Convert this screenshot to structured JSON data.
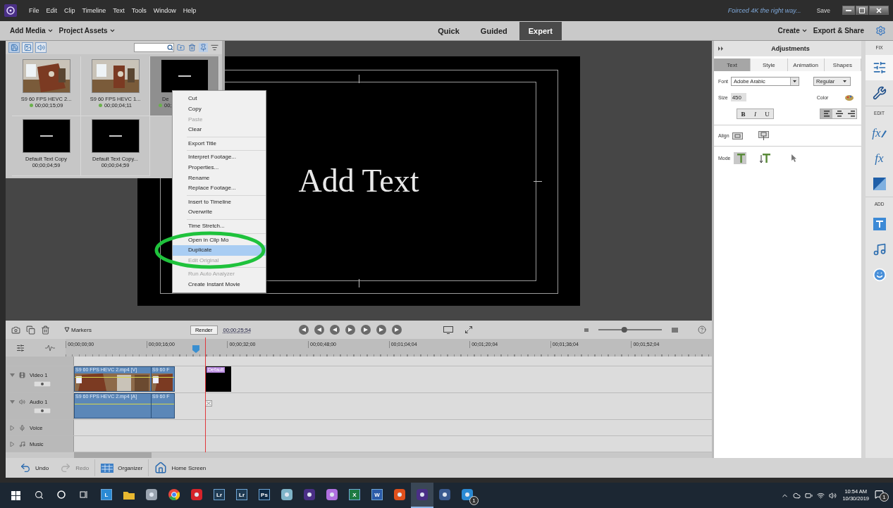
{
  "window": {
    "menu": [
      "File",
      "Edit",
      "Clip",
      "Timeline",
      "Text",
      "Tools",
      "Window",
      "Help"
    ],
    "project_title": "Foirced 4K the right way...",
    "save_label": "Save"
  },
  "toolbar": {
    "add_media": "Add Media",
    "project_assets": "Project Assets",
    "modes": [
      {
        "label": "Quick",
        "selected": false
      },
      {
        "label": "Guided",
        "selected": false
      },
      {
        "label": "Expert",
        "selected": true
      }
    ],
    "create": "Create",
    "export": "Export & Share"
  },
  "assets": {
    "items": [
      {
        "name": "S9 60 FPS HEVC 2...",
        "duration": "00;00;15;09",
        "kind": "video",
        "selected": false,
        "used": true
      },
      {
        "name": "S9 60 FPS HEVC 1...",
        "duration": "00;00;04;11",
        "kind": "video",
        "selected": false,
        "used": true
      },
      {
        "name": "De",
        "duration": "00;",
        "kind": "title",
        "selected": true,
        "used": true
      },
      {
        "name": "Default Text Copy",
        "duration": "00;00;04;59",
        "kind": "title",
        "selected": false,
        "used": false
      },
      {
        "name": "Default Text Copy...",
        "duration": "00;00;04;59",
        "kind": "title",
        "selected": false,
        "used": false
      }
    ]
  },
  "context_menu": {
    "groups": [
      [
        {
          "label": "Cut",
          "disabled": false,
          "selected": false
        },
        {
          "label": "Copy",
          "disabled": false,
          "selected": false
        },
        {
          "label": "Paste",
          "disabled": true,
          "selected": false
        },
        {
          "label": "Clear",
          "disabled": false,
          "selected": false
        }
      ],
      [
        {
          "label": "Export Title",
          "disabled": false,
          "selected": false
        }
      ],
      [
        {
          "label": "Interpret Footage...",
          "disabled": false,
          "selected": false
        },
        {
          "label": "Properties...",
          "disabled": false,
          "selected": false
        },
        {
          "label": "Rename",
          "disabled": false,
          "selected": false
        },
        {
          "label": "Replace Footage...",
          "disabled": false,
          "selected": false
        }
      ],
      [
        {
          "label": "Insert to Timeline",
          "disabled": false,
          "selected": false
        },
        {
          "label": "Overwrite",
          "disabled": false,
          "selected": false
        }
      ],
      [
        {
          "label": "Time Stretch...",
          "disabled": false,
          "selected": false
        }
      ],
      [
        {
          "label": "Open in Clip Mo",
          "disabled": false,
          "selected": false
        },
        {
          "label": "Duplicate",
          "disabled": false,
          "selected": true
        },
        {
          "label": "Edit Original",
          "disabled": true,
          "selected": false
        }
      ],
      [
        {
          "label": "Run Auto Analyzer",
          "disabled": true,
          "selected": false
        },
        {
          "label": "Create Instant Movie",
          "disabled": false,
          "selected": false
        }
      ]
    ]
  },
  "preview": {
    "text": "Add Text"
  },
  "adjustments": {
    "title": "Adjustments",
    "tabs": [
      {
        "label": "Text",
        "selected": true
      },
      {
        "label": "Style",
        "selected": false
      },
      {
        "label": "Animation",
        "selected": false
      },
      {
        "label": "Shapes",
        "selected": false
      }
    ],
    "font_label": "Font",
    "font": "Adobe Arabic",
    "style": "Regular",
    "size_label": "Size",
    "size": "450",
    "color_label": "Color",
    "format": [
      {
        "label": "B",
        "kind": "bold"
      },
      {
        "label": "I",
        "kind": "italic"
      },
      {
        "label": "U",
        "kind": "underline"
      }
    ],
    "text_align": [
      {
        "kind": "left",
        "selected": true
      },
      {
        "kind": "center",
        "selected": false
      },
      {
        "kind": "right",
        "selected": false
      }
    ],
    "align_label": "Align",
    "mode_label": "Mode",
    "modes": [
      {
        "kind": "horizontal",
        "selected": true
      },
      {
        "kind": "vertical",
        "selected": false
      }
    ]
  },
  "rail": {
    "sections": [
      {
        "label": "FIX",
        "tools": [
          {
            "kind": "adjust",
            "selected": true
          },
          {
            "kind": "tools",
            "selected": false
          }
        ]
      },
      {
        "label": "EDIT",
        "tools": [
          {
            "kind": "effects-edit",
            "glyph": "fx",
            "selected": false
          },
          {
            "kind": "effects",
            "glyph": "fx",
            "selected": false
          },
          {
            "kind": "transitions",
            "selected": false
          }
        ]
      },
      {
        "label": "ADD",
        "tools": [
          {
            "kind": "titles",
            "selected": false
          },
          {
            "kind": "music",
            "selected": false
          },
          {
            "kind": "graphics",
            "selected": false
          }
        ]
      }
    ]
  },
  "timeline": {
    "zoom": {
      "level": 0.4
    },
    "markers": "Markers",
    "render": "Render",
    "timecode": "00;00;25;54",
    "ruler": [
      "00;00;00;00",
      "00;00;16;00",
      "00;00;32;00",
      "00;00;48;00",
      "00;01;04;04",
      "00;01;20;04",
      "00;01;36;04",
      "00;01;52;04"
    ],
    "tracks": [
      {
        "name": "Video 1",
        "kind": "video",
        "expanded": true,
        "clips": [
          {
            "label": "S9 60 FPS HEVC 2.mp4 [V]",
            "kind": "video"
          },
          {
            "label": "S9 60 F",
            "kind": "video"
          },
          {
            "label": "Default",
            "kind": "title"
          }
        ]
      },
      {
        "name": "Audio 1",
        "kind": "audio",
        "expanded": true,
        "clips": [
          {
            "label": "S9 60 FPS HEVC 2.mp4 [A]",
            "kind": "audio"
          },
          {
            "label": "S9 60 F",
            "kind": "audio"
          }
        ]
      },
      {
        "name": "Voice",
        "kind": "voice",
        "expanded": false
      },
      {
        "name": "Music",
        "kind": "music",
        "expanded": false
      }
    ]
  },
  "bottom_bar": [
    {
      "label": "Undo",
      "kind": "undo",
      "disabled": false
    },
    {
      "label": "Redo",
      "kind": "redo",
      "disabled": true
    },
    {
      "label": "Organizer",
      "kind": "organizer",
      "disabled": false
    },
    {
      "label": "Home Screen",
      "kind": "home",
      "disabled": false
    }
  ],
  "taskbar": {
    "apps": [
      {
        "kind": "tile",
        "glyph": "L",
        "color": "#2a8ad4",
        "selected": false
      },
      {
        "kind": "folder",
        "color": "#e8b830",
        "selected": false
      },
      {
        "kind": "shape",
        "color": "#9aa4b0",
        "selected": false
      },
      {
        "kind": "chrome",
        "color": "#e8453c",
        "selected": false
      },
      {
        "kind": "shape",
        "color": "#d6232a",
        "selected": false
      },
      {
        "kind": "tile",
        "glyph": "Lr",
        "color": "#1f3a52",
        "selected": false
      },
      {
        "kind": "tile",
        "glyph": "Lr",
        "color": "#1f3a52",
        "selected": false
      },
      {
        "kind": "tile",
        "glyph": "Ps",
        "color": "#0f2a45",
        "selected": false
      },
      {
        "kind": "shape",
        "color": "#7fb4c8",
        "selected": false
      },
      {
        "kind": "shape",
        "color": "#4a2f86",
        "selected": false
      },
      {
        "kind": "shape",
        "color": "#b070e0",
        "selected": false
      },
      {
        "kind": "tile",
        "glyph": "X",
        "color": "#1d7a43",
        "selected": false
      },
      {
        "kind": "tile",
        "glyph": "W",
        "color": "#2b5ba8",
        "selected": false
      },
      {
        "kind": "shape",
        "color": "#e0501c",
        "selected": false
      },
      {
        "kind": "shape",
        "color": "#4a2f86",
        "selected": true
      },
      {
        "kind": "shape",
        "color": "#3a5a90",
        "selected": false
      },
      {
        "kind": "shape",
        "color": "#2a8ad4",
        "selected": false,
        "badge": "1"
      }
    ],
    "time": "10:54 AM",
    "date": "10/30/2019",
    "notification_badge": "1"
  }
}
